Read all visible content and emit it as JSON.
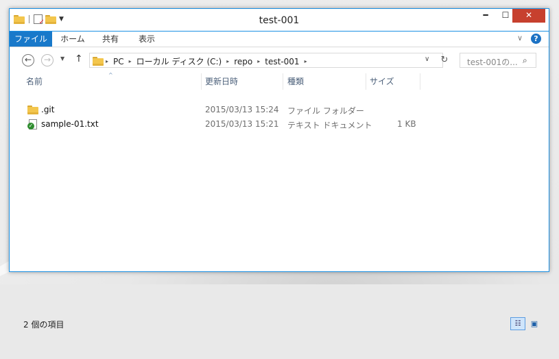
{
  "window": {
    "title": "test-001",
    "controls": {
      "minimize": "━",
      "maximize": "☐",
      "close": "✕"
    }
  },
  "quick_access": {
    "icons": [
      "folder-icon",
      "properties-icon",
      "new-folder-icon",
      "customize-dropdown-icon"
    ]
  },
  "ribbon": {
    "tabs": [
      {
        "label": "ファイル",
        "active": true
      },
      {
        "label": "ホーム"
      },
      {
        "label": "共有"
      },
      {
        "label": "表示"
      }
    ],
    "expand_glyph": "∨",
    "help_glyph": "?"
  },
  "navigation": {
    "back_glyph": "←",
    "forward_glyph": "→",
    "recent_glyph": "▼",
    "up_glyph": "↑",
    "breadcrumb": [
      "PC",
      "ローカル ディスク (C:)",
      "repo",
      "test-001"
    ],
    "chevron_glyph": "▸",
    "address_drop_glyph": "∨",
    "refresh_glyph": "↻"
  },
  "search": {
    "placeholder": "test-001の...",
    "icon_glyph": "⌕"
  },
  "columns": {
    "name": "名前",
    "modified": "更新日時",
    "type": "種類",
    "size": "サイズ",
    "sort_glyph": "^"
  },
  "files": [
    {
      "name": ".git",
      "modified": "2015/03/13 15:24",
      "type": "ファイル フォルダー",
      "size": "",
      "icon": "folder-icon"
    },
    {
      "name": "sample-01.txt",
      "modified": "2015/03/13 15:21",
      "type": "テキスト ドキュメント",
      "size": "1 KB",
      "icon": "text-file-icon"
    }
  ],
  "status": {
    "item_count": "2 個の項目"
  },
  "view": {
    "details_glyph": "☷",
    "large_icons_glyph": "▣"
  },
  "colors": {
    "accent": "#1979ca",
    "window_border": "#1a90e4",
    "close_button": "#c7402e"
  }
}
